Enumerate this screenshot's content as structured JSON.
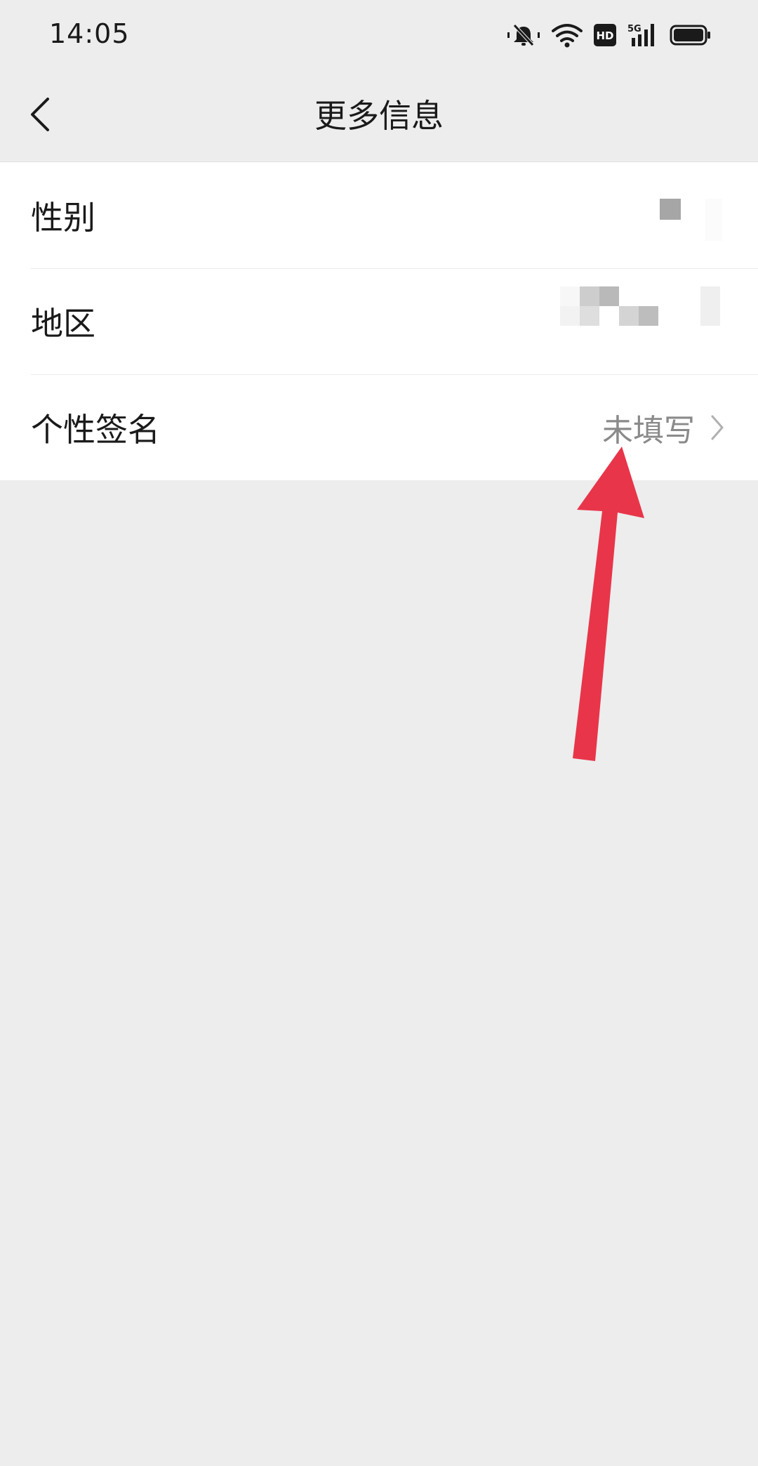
{
  "status_bar": {
    "time": "14:05",
    "icons": [
      "mute-icon",
      "wifi-icon",
      "hd-icon",
      "5g-signal-icon",
      "battery-icon"
    ],
    "network_label": "5G",
    "hd_label": "HD"
  },
  "nav": {
    "title": "更多信息",
    "back_icon": "chevron-left-icon"
  },
  "rows": [
    {
      "label": "性别",
      "value": "",
      "value_obscured": true
    },
    {
      "label": "地区",
      "value": "",
      "value_obscured": true
    },
    {
      "label": "个性签名",
      "value": "未填写",
      "chevron": "chevron-right-icon"
    }
  ],
  "colors": {
    "background": "#ededed",
    "list_background": "#ffffff",
    "annotation_arrow": "#e8354a",
    "secondary_text": "#8a8a8a"
  }
}
